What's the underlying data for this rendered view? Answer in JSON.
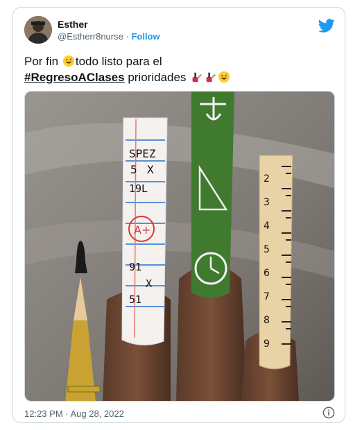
{
  "author": {
    "name": "Esther",
    "handle": "@Estherr8nurse",
    "separator": "·",
    "follow_label": "Follow"
  },
  "tweet": {
    "line1_before": "Por fin",
    "line1_after": "todo listo para el",
    "hashtag": "#RegresoAClases",
    "line2_after": "prioridades"
  },
  "media": {
    "ruler_numbers": [
      "2",
      "3",
      "4",
      "5",
      "6",
      "7",
      "8",
      "9"
    ],
    "paper_lines": [
      "SPEZ",
      "5",
      "X",
      "19L",
      "A+",
      "91",
      "X",
      "51"
    ]
  },
  "meta": {
    "timestamp": "12:23 PM · Aug 28, 2022"
  },
  "icons": {
    "brand": "twitter-bird-icon",
    "info": "info-icon"
  },
  "colors": {
    "twitter_blue": "#1d9bf0",
    "text": "#0f1419",
    "muted": "#536471",
    "border": "#cfd9de"
  }
}
